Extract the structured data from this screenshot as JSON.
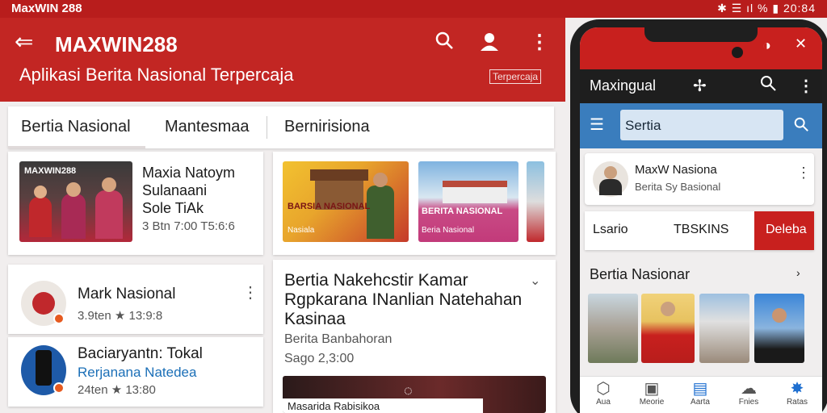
{
  "status_bar": {
    "title": "MaxWIN 288",
    "right": "✱ ☰ ıl % ▮ 20:84"
  },
  "app_bar": {
    "title": "MAXWIN288",
    "subtitle": "Aplikasi Berita Nasional Terpercaja",
    "badge": "Terpercaja"
  },
  "tabs": [
    "Bertia Nasional",
    "Mantesmaa",
    "Bernirisiona"
  ],
  "cards": {
    "c1": {
      "title1": "Maxia Natoym",
      "title2": "Sulanaani",
      "title3": "Sole TiAk",
      "meta": "3 Btn 7:00 T5:6:6",
      "thumb_text": "MAXWIN288"
    },
    "c2": {
      "thumb1_title": "BARSIA NASIONAL",
      "thumb1_sub": "Nasiala",
      "thumb2_title": "BERITA NASIONAL",
      "thumb2_sub": "Beria Nasional"
    },
    "c3": {
      "title": "Mark Nasional",
      "meta": "3.9ten ★ 13:9:8"
    },
    "c4": {
      "title1": "Baciaryantn: Tokal",
      "title2": "Rerjanana Natedea",
      "meta": "24ten ★ 13:80"
    },
    "c5": {
      "title1": "Bertia Nakehcstir Kamar",
      "title2": "Rgpkarana INanlian Natehahan",
      "title3": "Kasinaa",
      "meta1": "Berita Banbahoran",
      "meta2": "Sago 2,3:00",
      "footer": "Masarida Rabisikoa"
    }
  },
  "phone": {
    "header_title": "Maxingual",
    "search_value": "Sertia",
    "profile_name": "MaxW Nasiona",
    "profile_sub": "Berita Sy Basional",
    "seg_left": "Lsario",
    "seg_mid": "TBSKINS",
    "seg_right": "Deleba",
    "section": "Bertia Nasionar",
    "nav": [
      "Aua",
      "Meorie",
      "Aarta",
      "Fnies",
      "Ratas"
    ]
  },
  "colors": {
    "primary": "#c22623",
    "dark": "#1e1e1e",
    "blue": "#3a7dbd"
  },
  "icons": [
    "back-arrow-icon",
    "search-icon",
    "user-icon",
    "more-vert-icon",
    "chevron-down-icon",
    "menu-icon",
    "location-icon"
  ]
}
